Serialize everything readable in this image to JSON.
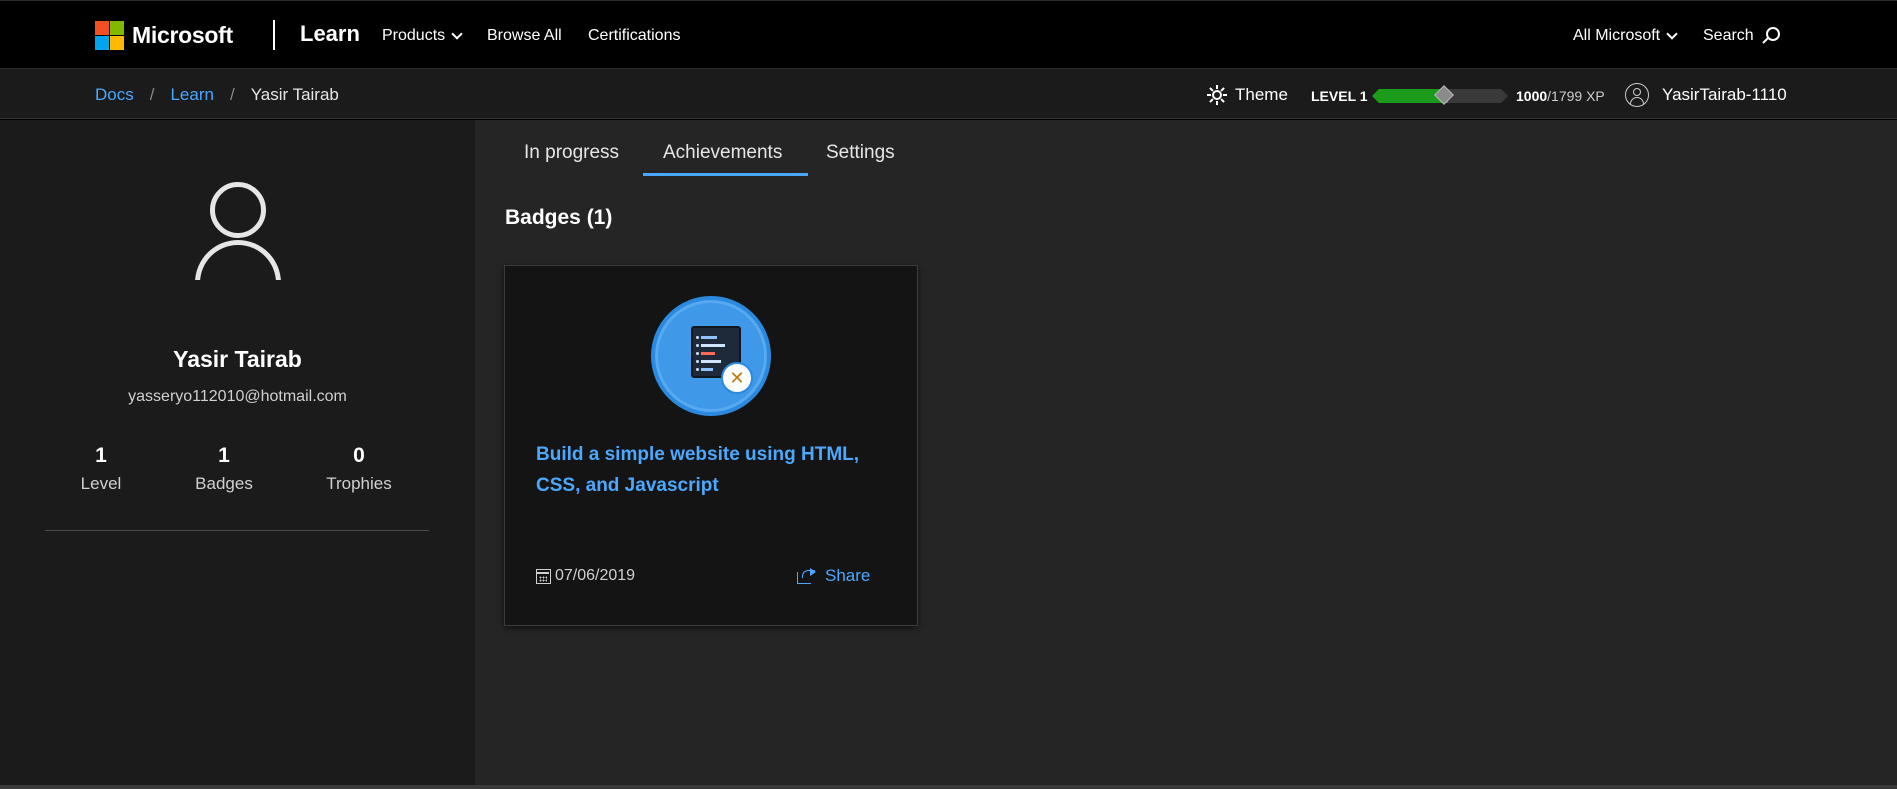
{
  "header": {
    "brand": "Microsoft",
    "site_title": "Learn",
    "nav": [
      {
        "label": "Products",
        "dropdown": true
      },
      {
        "label": "Browse All",
        "dropdown": false
      },
      {
        "label": "Certifications",
        "dropdown": false
      }
    ],
    "all_microsoft_label": "All Microsoft",
    "search_label": "Search",
    "logo_colors": [
      "#f25022",
      "#7fba00",
      "#00a4ef",
      "#ffb900"
    ]
  },
  "subbar": {
    "breadcrumb": [
      {
        "label": "Docs",
        "link": true
      },
      {
        "label": "Learn",
        "link": true
      },
      {
        "label": "Yasir Tairab",
        "link": false
      }
    ],
    "breadcrumb_separator": "/",
    "theme_label": "Theme",
    "level_label": "LEVEL 1",
    "xp_current": "1000",
    "xp_total": "/1799 XP",
    "xp_progress": 0.556,
    "username": "YasirTairab-1110"
  },
  "profile": {
    "name": "Yasir Tairab",
    "email": "yasseryo112010@hotmail.com",
    "stats": [
      {
        "value": "1",
        "label": "Level"
      },
      {
        "value": "1",
        "label": "Badges"
      },
      {
        "value": "0",
        "label": "Trophies"
      }
    ]
  },
  "tabs": [
    {
      "label": "In progress",
      "active": false
    },
    {
      "label": "Achievements",
      "active": true
    },
    {
      "label": "Settings",
      "active": false
    }
  ],
  "badges_section": {
    "title": "Badges (1)",
    "items": [
      {
        "title": "Build a simple website using HTML, CSS, and Javascript",
        "date": "07/06/2019",
        "share_label": "Share",
        "icon": "code-editor-tools-icon"
      }
    ]
  },
  "colors": {
    "accent": "#4ca8ff",
    "xp_fill": "#1a9b1a",
    "badge_blue": "#3f98e8"
  }
}
